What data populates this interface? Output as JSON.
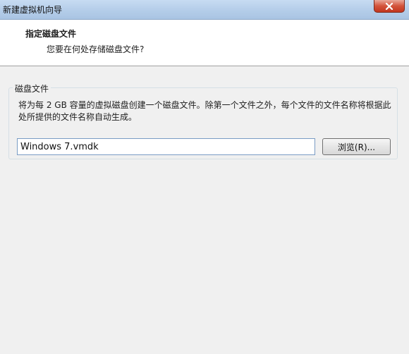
{
  "window": {
    "title": "新建虚拟机向导",
    "close_icon": "close-icon"
  },
  "header": {
    "title": "指定磁盘文件",
    "subtitle": "您要在何处存储磁盘文件?"
  },
  "disk_file_group": {
    "label": "磁盘文件",
    "description": "将为每 2 GB 容量的虚拟磁盘创建一个磁盘文件。除第一个文件之外，每个文件的文件名称将根据此处所提供的文件名称自动生成。",
    "file_name_value": "Windows 7.vmdk",
    "browse_label": "浏览(R)..."
  },
  "colors": {
    "title_bar": "#b9d1ea",
    "close_button": "#c7422b",
    "background": "#f0f0f0",
    "header_background": "#ffffff"
  }
}
